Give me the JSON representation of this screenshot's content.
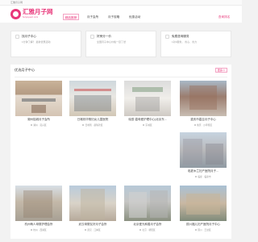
{
  "topbar": {
    "welcome": "汇雅月子网"
  },
  "brand": {
    "name": "汇雅月子网",
    "subtitle": "huiyayuezi.com",
    "accent": "#e8377a"
  },
  "nav": {
    "items": [
      "精品推荐",
      "月子会所",
      "月子攻略",
      "优惠活动"
    ],
    "active_index": 0,
    "right_item": "查询排名"
  },
  "info_cards": [
    {
      "title": "找月子中心",
      "subtitle": "1分钟了解？ 最新优惠活动"
    },
    {
      "title": "好房分一价",
      "subtitle": "全国月子中心价格一目了然"
    },
    {
      "title": "免费咨询服务",
      "subtitle": "1对1服务， 省心、省力"
    }
  ],
  "section": {
    "title": "优选月子中心",
    "more": "更多>>",
    "centers": [
      {
        "name": "湖州铭城月子会所",
        "location": "湖州 · 吴兴区"
      },
      {
        "name": "日喀则华阴妇女儿童医院",
        "location": "日喀则 · 桑珠孜区"
      },
      {
        "name": "晓辰·嘉母爱护理中心(北京东...",
        "location": "东城区"
      },
      {
        "name": "重庆市嘉吉月子中心",
        "location": "重庆 · 沙坪坝区"
      },
      {
        "name": "临夏木兰妇产医院月子...",
        "location": "临夏 · 临夏市"
      },
      {
        "name": "杭州萌人母婴护理会所",
        "location": "杭州 · 西湖区"
      },
      {
        "name": "武汉母婴友好月子会所",
        "location": "武汉 · 江岸区"
      },
      {
        "name": "北京爱光和善月子会所",
        "location": "北京 · 朝阳区"
      },
      {
        "name": "铜川福儿妇产医院月子中心",
        "location": "铜川 · 王益区"
      }
    ]
  }
}
